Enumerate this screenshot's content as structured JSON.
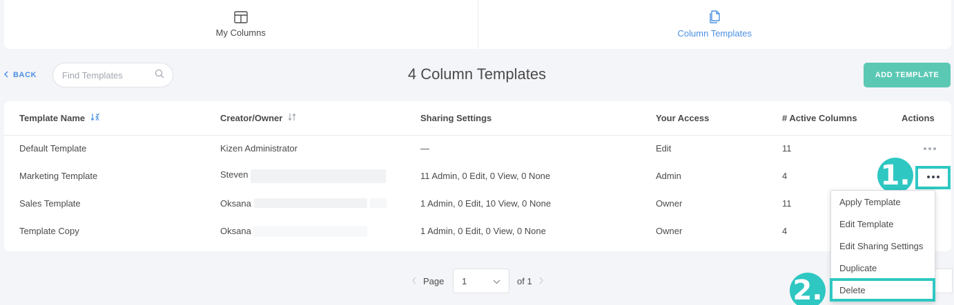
{
  "tabs": [
    {
      "label": "My Columns",
      "icon": "columns-icon",
      "active": false
    },
    {
      "label": "Column Templates",
      "icon": "templates-icon",
      "active": true
    }
  ],
  "toolbar": {
    "back_label": "BACK",
    "search_placeholder": "Find Templates",
    "title": "4 Column Templates",
    "add_label": "ADD TEMPLATE"
  },
  "table": {
    "columns": [
      "Template Name",
      "Creator/Owner",
      "Sharing Settings",
      "Your Access",
      "# Active Columns",
      "Actions"
    ],
    "rows": [
      {
        "name": "Default Template",
        "owner": "Kizen Administrator",
        "sharing": "—",
        "access": "Edit",
        "active_columns": "11"
      },
      {
        "name": "Marketing Template",
        "owner": "Steven",
        "sharing": "11 Admin, 0 Edit, 0 View, 0 None",
        "access": "Admin",
        "active_columns": "4"
      },
      {
        "name": "Sales Template",
        "owner": "Oksana",
        "sharing": "1 Admin, 0 Edit, 10 View, 0 None",
        "access": "Owner",
        "active_columns": "11"
      },
      {
        "name": "Template Copy",
        "owner": "Oksana",
        "sharing": "1 Admin, 0 Edit, 0 View, 0 None",
        "access": "Owner",
        "active_columns": "4"
      }
    ]
  },
  "pagination": {
    "page_label": "Page",
    "current_page": "1",
    "of_label": "of 1"
  },
  "actions_menu": {
    "items": [
      "Apply Template",
      "Edit Template",
      "Edit Sharing Settings",
      "Duplicate",
      "Delete"
    ]
  },
  "annotations": {
    "step1": "1.",
    "step2": "2."
  },
  "colors": {
    "accent_blue": "#4a90e2",
    "add_button": "#5bc8b4",
    "annotation": "#2ec7c2",
    "background": "#f4f5f8"
  }
}
